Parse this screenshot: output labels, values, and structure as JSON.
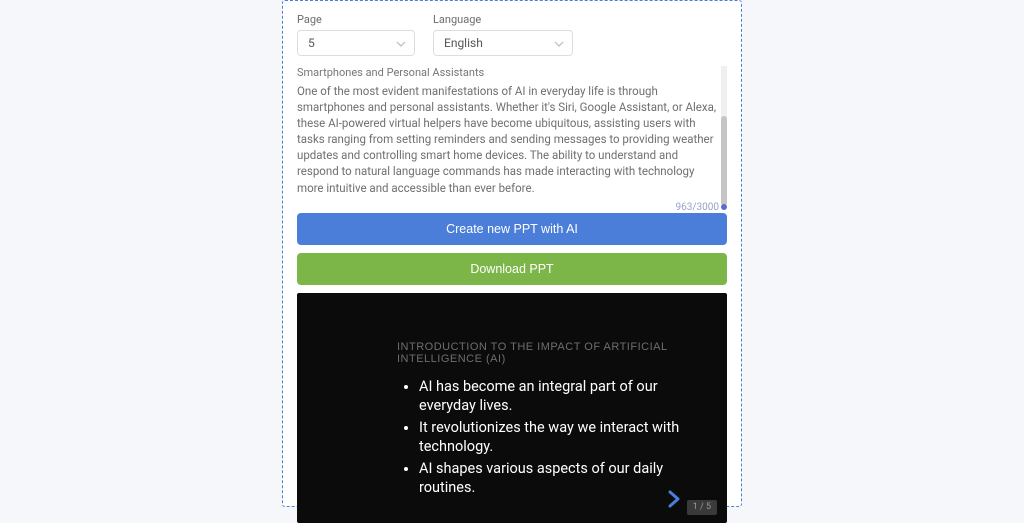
{
  "form": {
    "page_label": "Page",
    "page_value": "5",
    "language_label": "Language",
    "language_value": "English"
  },
  "content": {
    "section_heading": "Smartphones and Personal Assistants",
    "body": "One of the most evident manifestations of AI in everyday life is through smartphones and personal assistants. Whether it's Siri, Google Assistant, or Alexa, these AI-powered virtual helpers have become ubiquitous, assisting users with tasks ranging from setting reminders and sending messages to providing weather updates and controlling smart home devices. The ability to understand and respond to natural language commands has made interacting with technology more intuitive and accessible than ever before."
  },
  "char_counter": "963/3000",
  "buttons": {
    "create": "Create new PPT with AI",
    "download": "Download PPT"
  },
  "slide": {
    "title": "INTRODUCTION TO THE IMPACT OF ARTIFICIAL INTELLIGENCE (AI)",
    "bullets": [
      "AI has become an integral part of our everyday lives.",
      "It revolutionizes the way we interact with technology.",
      "AI shapes various aspects of our daily routines."
    ],
    "page_indicator": "1 / 5"
  }
}
